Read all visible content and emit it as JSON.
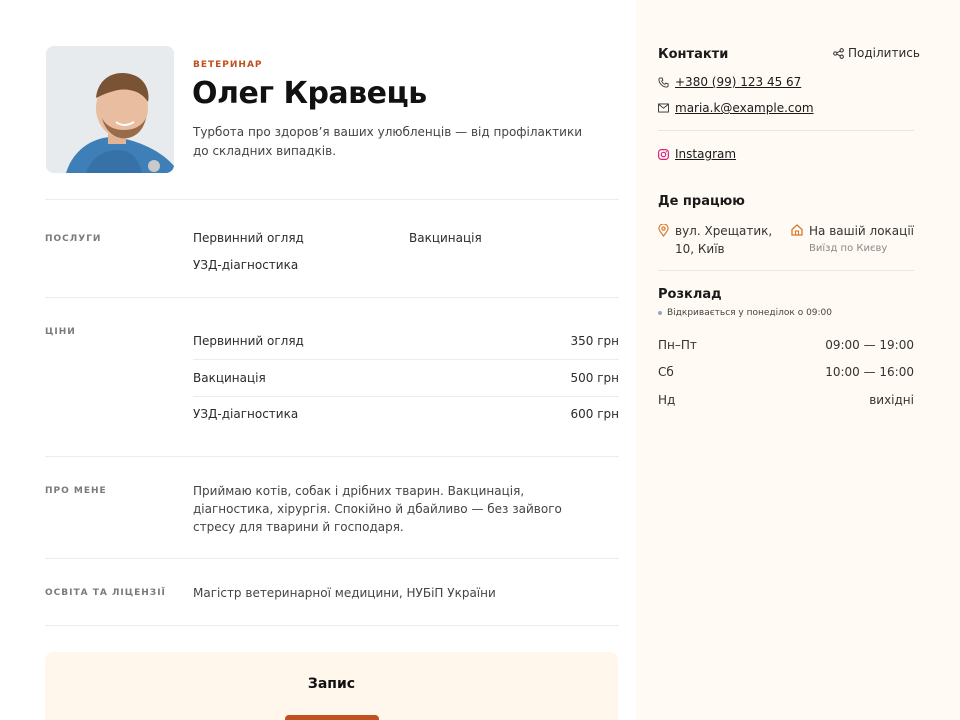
{
  "profile": {
    "role": "ВЕТЕРИНАР",
    "name": "Олег Кравець",
    "tagline": "Турбота про здоров’я ваших улюбленців — від профілактики до складних випадків."
  },
  "services": {
    "label": "ПОСЛУГИ",
    "items": [
      "Первинний огляд",
      "Вакцинація",
      "УЗД-діагностика"
    ]
  },
  "prices": {
    "label": "ЦІНИ",
    "rows": [
      {
        "name": "Первинний огляд",
        "price": "350 грн"
      },
      {
        "name": "Вакцинація",
        "price": "500 грн"
      },
      {
        "name": "УЗД-діагностика",
        "price": "600 грн"
      }
    ]
  },
  "about": {
    "label": "ПРО МЕНЕ",
    "text": "Приймаю котів, собак і дрібних тварин. Вакцинація, діагностика, хірургія. Спокійно й дбайливо — без зайвого стресу для тварини й господаря."
  },
  "education": {
    "label": "ОСВІТА ТА ЛІЦЕНЗІЇ",
    "text": "Магістр ветеринарної медицини, НУБіП України"
  },
  "booking": {
    "title": "Запис"
  },
  "sidebar": {
    "contacts_title": "Контакти",
    "share_label": "Поділитись",
    "phone": "+380 (99) 123 45 67",
    "email": "maria.k@example.com",
    "instagram": "Instagram",
    "work_title": "Де працюю",
    "address": "вул. Хрещатик, 10, Київ",
    "home_visit": "На вашій локації",
    "home_visit_sub": "Виїзд по Києву",
    "schedule_title": "Розклад",
    "open_note": "Відкривається у понеділок о 09:00",
    "schedule": [
      {
        "day": "Пн–Пт",
        "time": "09:00 — 19:00"
      },
      {
        "day": "Сб",
        "time": "10:00 — 16:00"
      },
      {
        "day": "Нд",
        "time": "вихідні"
      }
    ]
  },
  "colors": {
    "accent": "#c0501f",
    "sidebar_bg": "#fffaf3",
    "instagram": "#d6257a"
  }
}
